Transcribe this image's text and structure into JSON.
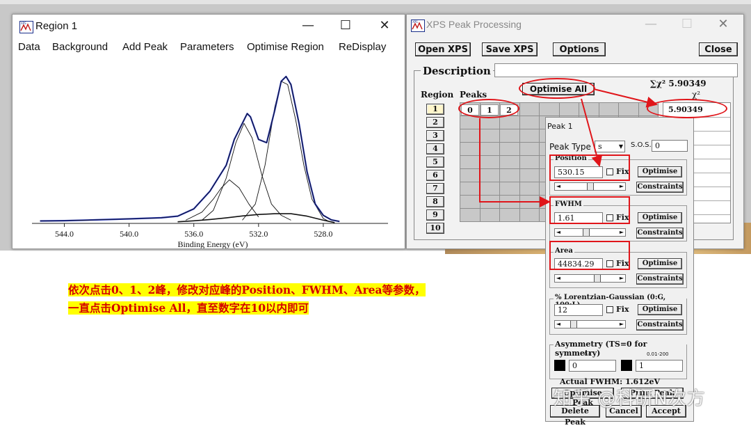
{
  "region_window": {
    "title": "Region 1",
    "menu": [
      "Data",
      "Background",
      "Add Peak",
      "Parameters",
      "Optimise Region",
      "ReDisplay"
    ],
    "controls": {
      "minimize": "—",
      "maximize": "☐",
      "close": "✕"
    },
    "chart_data": {
      "type": "line",
      "xlabel": "Binding Energy (eV)",
      "ylabel": "",
      "x_ticks": [
        "544.0",
        "540.0",
        "536.0",
        "532.0",
        "528.0"
      ],
      "xlim": [
        546,
        524
      ],
      "ylim": [
        0,
        1
      ],
      "x_reversed": true,
      "colors": {
        "data": "#2233bb",
        "fit": "#111111"
      },
      "series": [
        {
          "name": "",
          "role": "data",
          "x": [
            545.5,
            544,
            542,
            540,
            538,
            537,
            536,
            535,
            534,
            533.5,
            533,
            532.7,
            532.5,
            532,
            531.5,
            531,
            530.6,
            530.3,
            530,
            529.5,
            529,
            528.5,
            528,
            527.5,
            527
          ],
          "values": [
            0.015,
            0.017,
            0.022,
            0.028,
            0.035,
            0.045,
            0.09,
            0.2,
            0.36,
            0.52,
            0.62,
            0.68,
            0.66,
            0.52,
            0.5,
            0.7,
            0.88,
            0.91,
            0.86,
            0.62,
            0.32,
            0.12,
            0.05,
            0.022,
            0.012
          ]
        },
        {
          "name": "",
          "role": "background",
          "x": [
            537,
            536,
            535,
            534,
            533,
            532,
            531,
            530,
            529,
            528,
            527.3
          ],
          "values": [
            0.01,
            0.016,
            0.024,
            0.034,
            0.046,
            0.055,
            0.06,
            0.06,
            0.045,
            0.02,
            0.005
          ]
        },
        {
          "name": "",
          "role": "peak",
          "x": [
            536.5,
            535.5,
            534.8,
            534.3,
            533.8,
            533.2,
            532.6,
            532
          ],
          "values": [
            0.02,
            0.07,
            0.15,
            0.22,
            0.27,
            0.22,
            0.12,
            0.04
          ]
        },
        {
          "name": "",
          "role": "peak",
          "x": [
            535.5,
            534.8,
            534,
            533.4,
            532.9,
            532.4,
            531.8,
            531.2,
            530.6,
            530
          ],
          "values": [
            0.02,
            0.08,
            0.28,
            0.5,
            0.62,
            0.53,
            0.3,
            0.12,
            0.05,
            0.02
          ]
        },
        {
          "name": "",
          "role": "peak",
          "x": [
            533,
            532.2,
            531.6,
            531,
            530.6,
            530.2,
            529.7,
            529.2,
            528.7,
            528,
            527.6
          ],
          "values": [
            0.02,
            0.12,
            0.36,
            0.72,
            0.88,
            0.86,
            0.64,
            0.36,
            0.15,
            0.03,
            0.01
          ]
        }
      ]
    }
  },
  "xps_window": {
    "title": "XPS Peak Processing",
    "buttons": [
      "Open XPS",
      "Save XPS",
      "Options",
      "Close"
    ],
    "description_label": "Description",
    "sum_chi_label": "∑χ² 5.90349",
    "chi_header": "χ²",
    "region_header": "Region",
    "peaks_header": "Peaks",
    "optimise_all": "Optimise All",
    "regions": [
      "1",
      "2",
      "3",
      "4",
      "5",
      "6",
      "7",
      "8",
      "9",
      "10"
    ],
    "peaks": [
      "0",
      "1",
      "2"
    ],
    "chi_value": "5.90349"
  },
  "peak_dialog": {
    "title": "Peak 1",
    "peak_type_label": "Peak Type",
    "peak_type_value": "s",
    "sos_label": "S.O.S.",
    "sos_value": "0",
    "fix_label": "Fix",
    "optimise_label": "Optimise",
    "constraints_label": "Constraints",
    "position_label": "Position",
    "position_value": "530.15",
    "fwhm_label": "FWHM",
    "fwhm_value": "1.61",
    "area_label": "Area",
    "area_value": "44834.29",
    "lg_label": "% Lorentzian-Gaussian (0:G, 100:L)",
    "lg_value": "12",
    "asym_label": "Asymmetry (TS=0 for symmetry)",
    "asym_range_left": "0-1",
    "asym_range_right": "0.01-200",
    "asym_left_value": "0",
    "asym_right_value": "1",
    "actual_fwhm": "Actual FWHM: 1.612eV",
    "partial_buttons": [
      "Optimise Peak",
      "Print Peak"
    ],
    "bottom_buttons": [
      "Delete Peak",
      "Cancel",
      "Accept"
    ]
  },
  "annotation": {
    "line1": "依次点击0、1、2峰，修改对应峰的Position、FWHM、Area等参数，",
    "line2": "一直点击Optimise All，直至数字在10以内即可",
    "color": "#d40000",
    "highlight": "#ffff00"
  },
  "watermark": "知乎 @科研N次方"
}
